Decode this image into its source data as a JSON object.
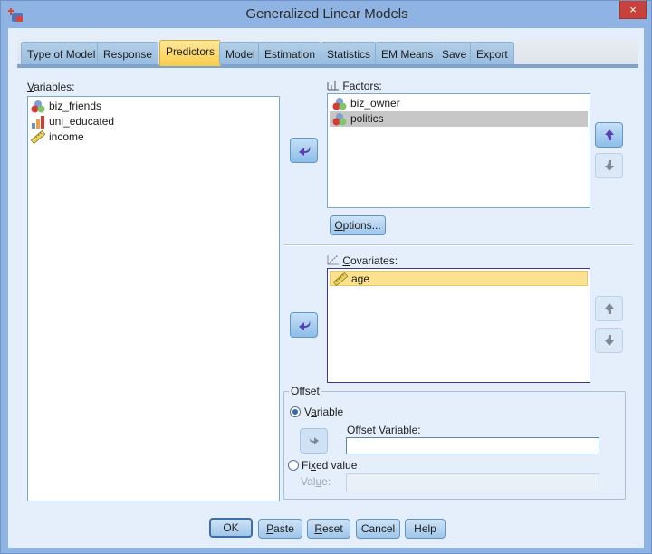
{
  "window": {
    "title": "Generalized Linear Models",
    "close_label": "×"
  },
  "tabs": [
    {
      "label": "Type of Model",
      "active": false
    },
    {
      "label": "Response",
      "active": false
    },
    {
      "label": "Predictors",
      "active": true
    },
    {
      "label": "Model",
      "active": false
    },
    {
      "label": "Estimation",
      "active": false
    },
    {
      "label": "Statistics",
      "active": false
    },
    {
      "label": "EM Means",
      "active": false
    },
    {
      "label": "Save",
      "active": false
    },
    {
      "label": "Export",
      "active": false
    }
  ],
  "variables": {
    "label_mnemonic": "V",
    "label_rest": "ariables:",
    "items": [
      {
        "name": "biz_friends",
        "icon": "nominal-icon"
      },
      {
        "name": "uni_educated",
        "icon": "ordinal-icon"
      },
      {
        "name": "income",
        "icon": "scale-icon"
      }
    ]
  },
  "factors": {
    "label_mnemonic": "F",
    "label_rest": "actors:",
    "items": [
      {
        "name": "biz_owner",
        "icon": "nominal-icon",
        "selected": false
      },
      {
        "name": "politics",
        "icon": "nominal-icon",
        "selected": true
      }
    ],
    "options_mnemonic": "O",
    "options_rest": "ptions..."
  },
  "covariates": {
    "label_mnemonic": "C",
    "label_rest": "ovariates:",
    "items": [
      {
        "name": "age",
        "icon": "scale-icon",
        "selected": true
      }
    ]
  },
  "offset": {
    "group_label": "Offset",
    "variable_radio_pre": "V",
    "variable_radio_mnemonic": "a",
    "variable_radio_post": "riable",
    "variable_selected": true,
    "offset_variable_pre": "Off",
    "offset_variable_mnemonic": "s",
    "offset_variable_post": "et Variable:",
    "offset_variable_value": "",
    "fixed_pre": "Fi",
    "fixed_mnemonic": "x",
    "fixed_post": "ed value",
    "fixed_selected": false,
    "value_pre": "Val",
    "value_mnemonic": "u",
    "value_post": "e:",
    "value_value": ""
  },
  "buttons": {
    "ok": "OK",
    "paste_mnemonic": "P",
    "paste_rest": "aste",
    "reset_mnemonic": "R",
    "reset_rest": "eset",
    "cancel": "Cancel",
    "help": "Help"
  }
}
